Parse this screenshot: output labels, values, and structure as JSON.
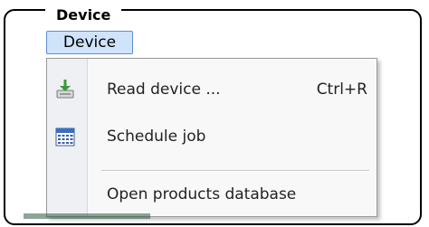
{
  "frame": {
    "title": "Device"
  },
  "menubar": {
    "device_label": "Device"
  },
  "menu": {
    "items": [
      {
        "label": "Read device ...",
        "shortcut": "Ctrl+R",
        "icon": "read-device-icon"
      },
      {
        "label": "Schedule job",
        "icon": "calendar-icon"
      },
      {
        "label": "Open products database"
      }
    ]
  },
  "colors": {
    "menubar_highlight": "#cfe3fb",
    "menubar_border": "#5d8fd0",
    "menu_background": "#f8f8f8"
  }
}
